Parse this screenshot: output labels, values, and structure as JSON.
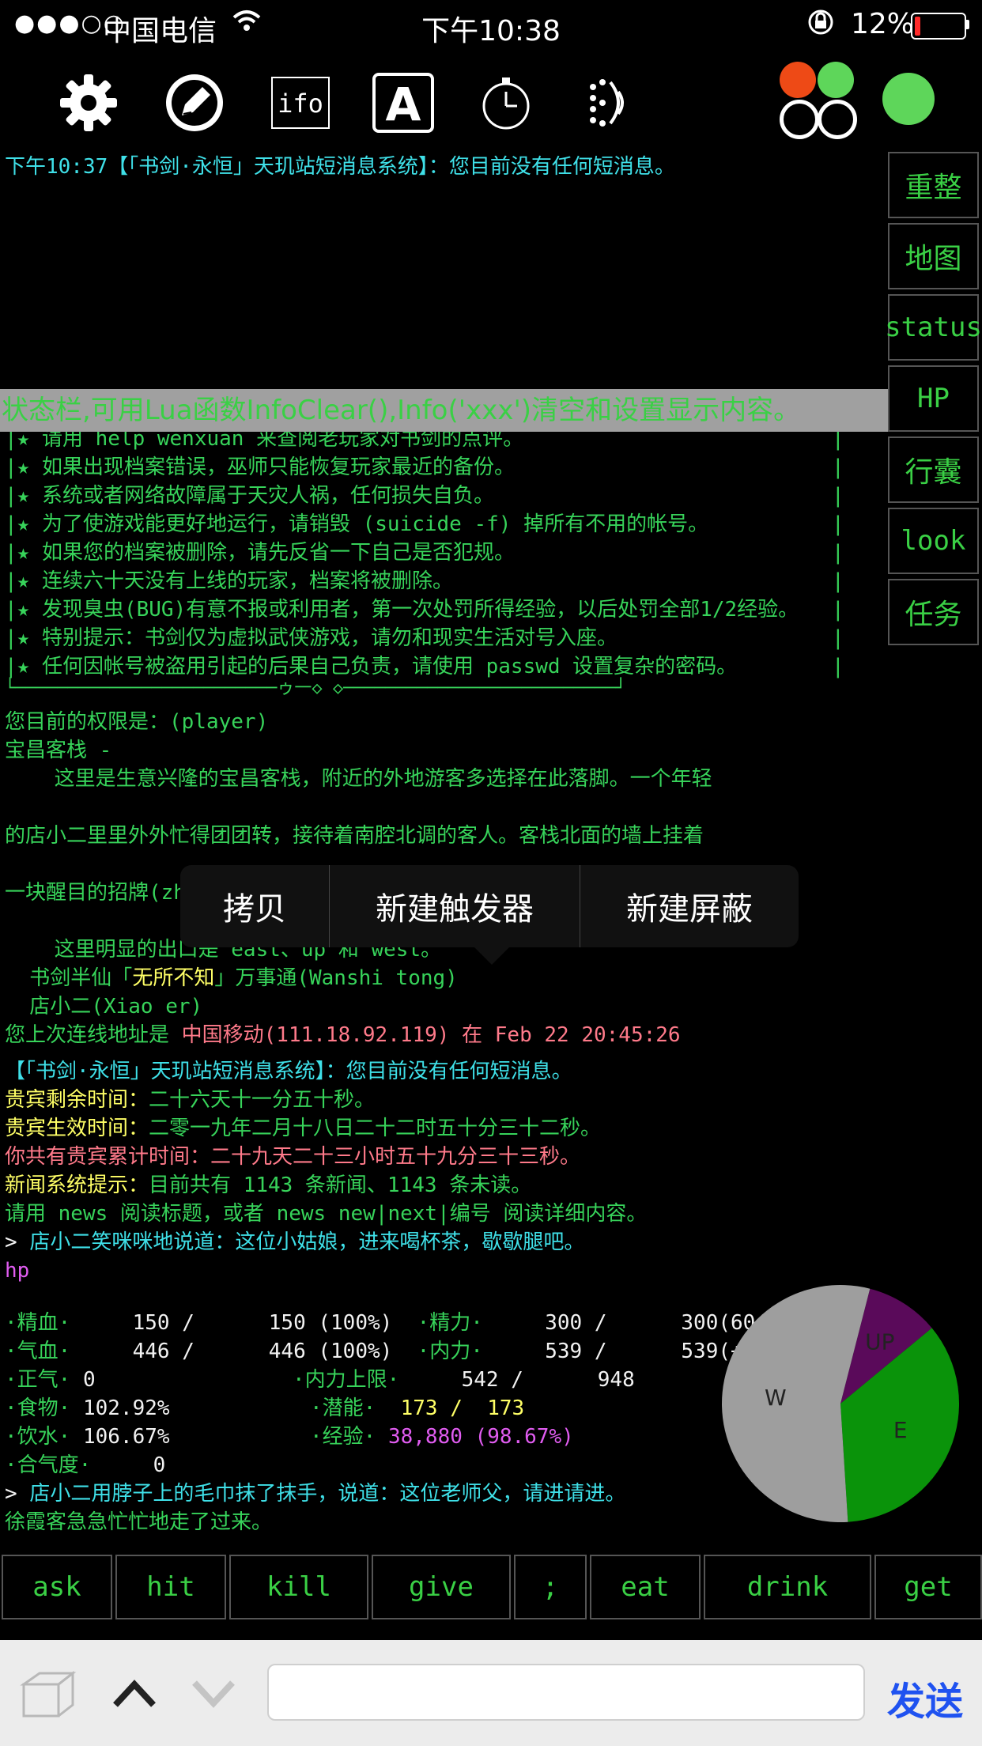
{
  "statusbar": {
    "signal": "●●●○○",
    "carrier": "中国电信",
    "time": "下午10:38",
    "battery": "12%",
    "battery_level": 0.12,
    "battery_color": "#ff2a2a"
  },
  "toolbar": {
    "icons": [
      "gear-icon",
      "compose-icon",
      "ifo-icon",
      "font-icon",
      "timer-icon",
      "speech-icon"
    ],
    "ifo_label": "ifo",
    "font_label": "A",
    "dot_colors": {
      "red": "#ee4a16",
      "green": "#5ed65a"
    }
  },
  "output": {
    "l1": {
      "a": "下午10:37",
      "b": "【「书剑·永恒」天玑站短消息系统】：您目前没有任何短消息。"
    },
    "box": [
      "|★ 请用 help wenxuan 来查阅老玩家对书剑的点评。",
      "|★ 如果出现档案错误，巫师只能恢复玩家最近的备份。",
      "|★ 系统或者网络故障属于天灾人祸，任何损失自负。",
      "|★ 为了使游戏能更好地运行，请销毁 (suicide -f) 掉所有不用的帐号。",
      "|★ 如果您的档案被删除，请先反省一下自己是否犯规。",
      "|★ 连续六十天没有上线的玩家，档案将被删除。",
      "|★ 发现臭虫(BUG)有意不报或利用者，第一次处罚所得经验，以后处罚全部1/2经验。",
      "|★ 特别提示：书剑仅为虚拟武侠游戏，请勿和现实生活对号入座。",
      "|★ 任何因帐号被盗用引起的后果自己负责，请使用 passwd 设置复杂的密码。"
    ],
    "box_end": "|",
    "box_bottom": "└─────────────────────────ゥ一◇ ◇──────────────────────────┘",
    "perm": "您目前的权限是：(player)",
    "room": "宝昌客栈 -",
    "desc1": "    这里是生意兴隆的宝昌客栈，附近的外地游客多选择在此落脚。一个年轻",
    "desc2": "的店小二里里外外忙得团团转，接待着南腔北调的客人。客栈北面的墙上挂着",
    "desc3": "一块醒目的招牌(zh",
    "exits": "    这里明显的出口是 east、up 和 west。",
    "npc1a": "  书剑半仙「",
    "npc1b": "无所不知",
    "npc1c": "」万事通(Wanshi tong)",
    "npc2": "  店小二(Xiao er)",
    "last_a": "您上次连线地址是 ",
    "last_b": "中国移动(111.18.92.119) 在 Feb 22 20:45:26",
    "msg2": "【「书剑·永恒」天玑站短消息系统】：您目前没有任何短消息。",
    "vip1a": "贵宾剩余时间：",
    "vip1b": "二十六天十一分五十秒。",
    "vip2a": "贵宾生效时间：",
    "vip2b": "二零一九年二月十八日二十二时五十分三十二秒。",
    "vip3a": "你共有贵宾累计时间：",
    "vip3b": "二十九天二十三小时五十九分三十三秒。",
    "news1a": "新闻系统提示：",
    "news1b": "目前共有 1143 条新闻、1143 条未读。",
    "news2": "请用 news 阅读标题，或者 news new|next|编号 阅读详细内容。",
    "say1a": "> ",
    "say1b": "店小二笑咪咪地说道：这位小姑娘，进来喝杯茶，歇歇腿吧。",
    "hp": "hp",
    "stats": {
      "r1a": "·精血·",
      "r1b": "     150 /      150 (100%)",
      "r1c": "  ·精力·",
      "r1d": "     300 /      300(604)",
      "r2a": "·气血·",
      "r2b": "     446 /      446 (100%)",
      "r2c": "  ·内力·",
      "r2d": "     539 /      539(+9)",
      "r3a": "·正气·",
      "r3b": " 0",
      "r3c": "·内力上限·",
      "r3d": "     542 /      948",
      "r4a": "·食物·",
      "r4b": " 102.92%",
      "r4c": "·潜能·",
      "r4d": "  173 /  173",
      "r5a": "·饮水·",
      "r5b": " 106.67%",
      "r5c": "·经验·",
      "r5d": " 38,880 (98.67%)",
      "r6a": "·合气度·",
      "r6b": "     0"
    },
    "say2a": "> ",
    "say2b": "店小二用脖子上的毛巾抹了抹手，说道：这位老师父，请进请进。",
    "last": "徐霞客急急忙忙地走了过来。"
  },
  "status_overlay": "状态栏,可用Lua函数InfoClear(),Info('xxx')清空和设置显示内容。",
  "right_buttons": [
    "重整",
    "地图",
    "status",
    "HP",
    "行囊",
    "look",
    "任务"
  ],
  "context_menu": [
    "拷贝",
    "新建触发器",
    "新建屏蔽"
  ],
  "pie": {
    "slices": [
      {
        "label": "W",
        "value": 55,
        "color": "#9e9e9e"
      },
      {
        "label": "UP",
        "value": 10,
        "color": "#5a0a5a"
      },
      {
        "label": "E",
        "value": 35,
        "color": "#0a930a"
      }
    ]
  },
  "commands": [
    "ask",
    "hit",
    "kill",
    "give",
    ";",
    "eat",
    "drink",
    "get"
  ],
  "input": {
    "value": "",
    "placeholder": ""
  },
  "send_label": "发送"
}
